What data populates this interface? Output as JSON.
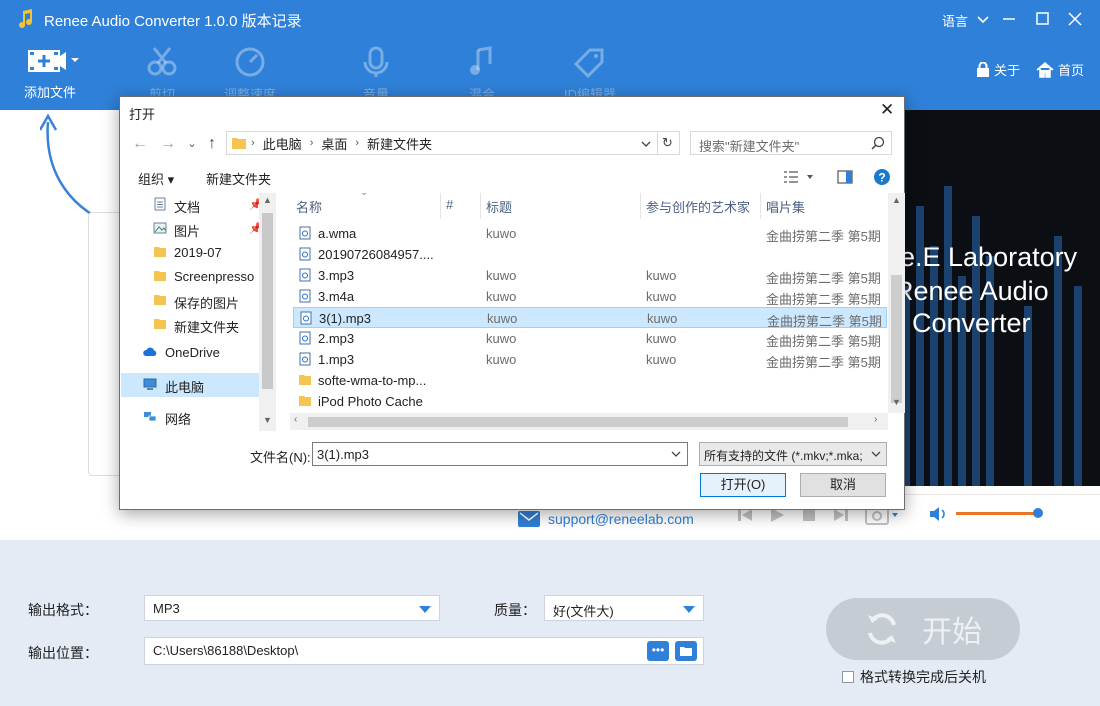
{
  "app": {
    "title": "Renee Audio Converter 1.0.0 版本记录",
    "language_label": "语言",
    "about_label": "关于",
    "home_label": "首页"
  },
  "toolbar": {
    "items": [
      {
        "label": "添加文件",
        "icon": "add-file-icon"
      },
      {
        "label": "剪切",
        "icon": "cut-icon"
      },
      {
        "label": "调整速度",
        "icon": "speed-icon"
      },
      {
        "label": "音量",
        "icon": "microphone-icon"
      },
      {
        "label": "混合",
        "icon": "mix-icon"
      },
      {
        "label": "ID编辑器",
        "icon": "tag-icon"
      }
    ]
  },
  "preview": {
    "lines": [
      "e.E Laboratory",
      "Renee Audio",
      "Converter"
    ]
  },
  "support": {
    "email": "support@reneelab.com"
  },
  "output": {
    "format_label": "输出格式：",
    "format_value": "MP3",
    "quality_label": "质量：",
    "quality_value": "好(文件大)",
    "location_label": "输出位置：",
    "location_value": "C:\\Users\\86188\\Desktop\\",
    "browse_more": "•••",
    "start_label": "开始",
    "shutdown_label": "格式转换完成后关机"
  },
  "dialog": {
    "title": "打开",
    "breadcrumb": [
      "此电脑",
      "桌面",
      "新建文件夹"
    ],
    "search_placeholder": "搜索\"新建文件夹\"",
    "organize_label": "组织",
    "new_folder_label": "新建文件夹",
    "tree": [
      {
        "label": "文档",
        "icon": "document-icon",
        "pinned": true
      },
      {
        "label": "图片",
        "icon": "pictures-icon",
        "pinned": true
      },
      {
        "label": "2019-07",
        "icon": "folder-icon"
      },
      {
        "label": "Screenpresso",
        "icon": "folder-icon"
      },
      {
        "label": "保存的图片",
        "icon": "folder-icon"
      },
      {
        "label": "新建文件夹",
        "icon": "folder-icon"
      },
      {
        "label": "OneDrive",
        "icon": "cloud-icon"
      },
      {
        "label": "此电脑",
        "icon": "computer-icon"
      },
      {
        "label": "网络",
        "icon": "network-icon"
      }
    ],
    "columns": [
      "名称",
      "#",
      "标题",
      "参与创作的艺术家",
      "唱片集"
    ],
    "files": [
      {
        "name": "a.wma",
        "title": "kuwo",
        "artist": "",
        "album": "金曲捞第二季 第5期",
        "type": "audio"
      },
      {
        "name": "20190726084957....",
        "title": "",
        "artist": "",
        "album": "",
        "type": "audio"
      },
      {
        "name": "3.mp3",
        "title": "kuwo",
        "artist": "kuwo",
        "album": "金曲捞第二季 第5期",
        "type": "audio"
      },
      {
        "name": "3.m4a",
        "title": "kuwo",
        "artist": "kuwo",
        "album": "金曲捞第二季 第5期",
        "type": "audio"
      },
      {
        "name": "3(1).mp3",
        "title": "kuwo",
        "artist": "kuwo",
        "album": "金曲捞第二季 第5期",
        "type": "audio",
        "selected": true
      },
      {
        "name": "2.mp3",
        "title": "kuwo",
        "artist": "kuwo",
        "album": "金曲捞第二季 第5期",
        "type": "audio"
      },
      {
        "name": "1.mp3",
        "title": "kuwo",
        "artist": "kuwo",
        "album": "金曲捞第二季 第5期",
        "type": "audio"
      },
      {
        "name": "softe-wma-to-mp...",
        "title": "",
        "artist": "",
        "album": "",
        "type": "folder"
      },
      {
        "name": "iPod Photo Cache",
        "title": "",
        "artist": "",
        "album": "",
        "type": "folder"
      }
    ],
    "filename_label": "文件名(N):",
    "filename_value": "3(1).mp3",
    "filetype_value": "所有支持的文件 (*.mkv;*.mka;",
    "open_button": "打开(O)",
    "cancel_button": "取消"
  },
  "colors": {
    "header_blue": "#2f80d8",
    "bottom_bg": "#e4ebf5",
    "selection": "#cce8ff",
    "volume_orange": "#e97528"
  }
}
